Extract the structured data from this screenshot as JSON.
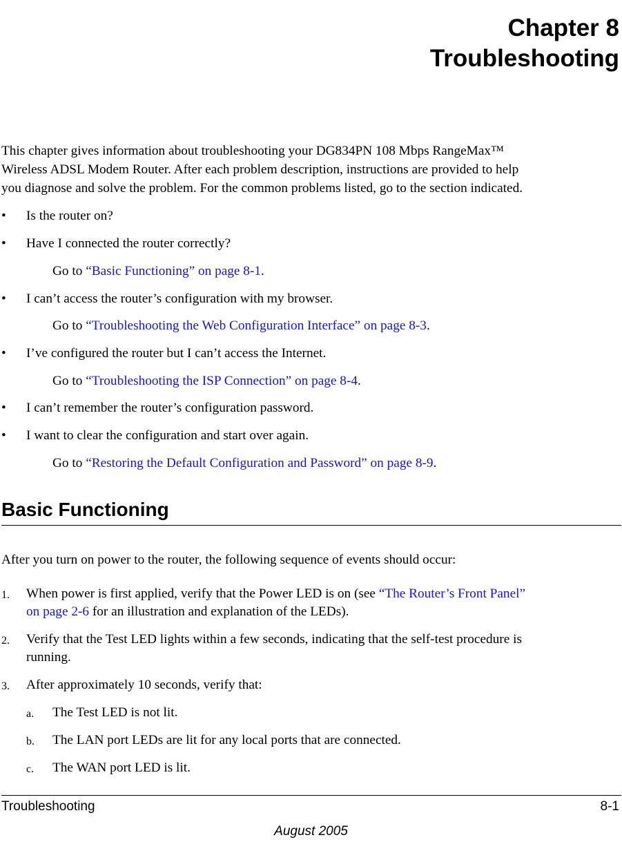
{
  "chapter": {
    "number_label": "Chapter 8",
    "title": "Troubleshooting"
  },
  "intro": {
    "lines": [
      "This chapter gives information about troubleshooting your DG834PN 108 Mbps RangeMax™",
      "Wireless ADSL Modem Router. After each problem description, instructions are provided to help",
      "you diagnose and solve the problem. For the common problems listed, go to the section indicated."
    ]
  },
  "problems": {
    "bullet": "•",
    "goto_prefix": "Go to ",
    "items": [
      {
        "text": "Is the router on?"
      },
      {
        "text": "Have I connected the router correctly?",
        "link": "“Basic Functioning” on page 8-1",
        "suffix": "."
      },
      {
        "text": "I can’t access the router’s configuration with my browser.",
        "link": "“Troubleshooting the Web Configuration Interface” on page 8-3",
        "suffix": "."
      },
      {
        "text": "I’ve configured the router but I can’t access the Internet.",
        "link": "“Troubleshooting the ISP Connection” on page 8-4",
        "suffix": "."
      },
      {
        "text": "I can’t remember the router’s configuration password."
      },
      {
        "text": "I want to clear the configuration and start over again.",
        "link": "“Restoring the Default Configuration and Password” on page 8-9",
        "suffix": "."
      }
    ]
  },
  "section": {
    "heading": "Basic Functioning",
    "lead": "After you turn on power to the router, the following sequence of events should occur:",
    "steps": [
      {
        "label": "1.",
        "line1_before": "When power is first applied, verify that the Power LED is on (see ",
        "line1_link": "“The Router’s Front Panel”",
        "line2_link": "on page 2-6",
        "line2_after": " for an illustration and explanation of the LEDs)."
      },
      {
        "label": "2.",
        "line1": "Verify that the Test LED lights within a few seconds, indicating that the self-test procedure is",
        "line2": "running."
      },
      {
        "label": "3.",
        "text": "After approximately 10 seconds, verify that:",
        "substeps": [
          {
            "label": "a.",
            "text": "The Test LED is not lit."
          },
          {
            "label": "b.",
            "text": "The LAN port LEDs are lit for any local ports that are connected."
          },
          {
            "label": "c.",
            "text": "The WAN port LED is lit."
          }
        ]
      }
    ]
  },
  "footer": {
    "left": "Troubleshooting",
    "right": "8-1",
    "date": "August 2005"
  },
  "colors": {
    "link": "#1414e6",
    "text": "#000000"
  }
}
